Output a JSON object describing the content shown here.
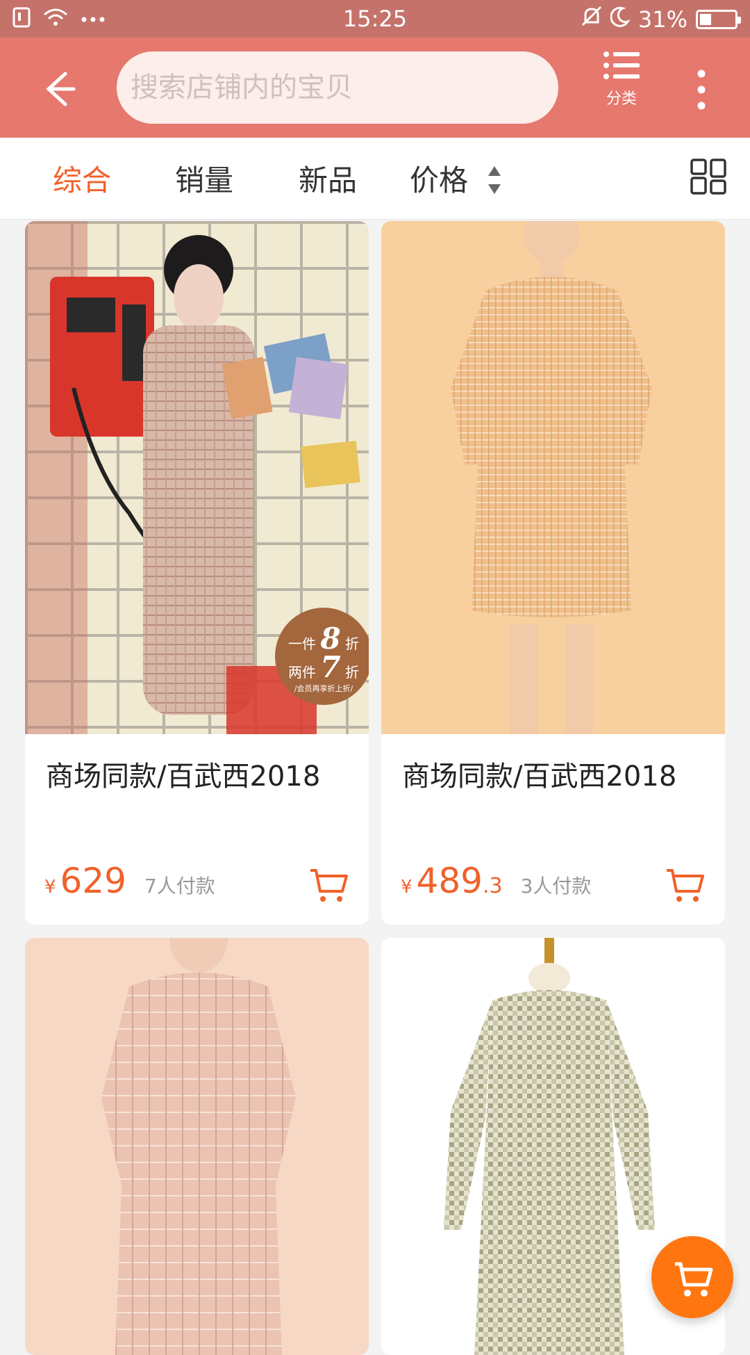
{
  "status_bar": {
    "time": "15:25",
    "battery": "31%"
  },
  "header": {
    "search_placeholder": "搜索店铺内的宝贝",
    "category_label": "分类",
    "icons": [
      "back-arrow-icon",
      "category-list-icon",
      "more-vertical-icon"
    ]
  },
  "tabs": [
    {
      "label": "综合",
      "active": true
    },
    {
      "label": "销量",
      "active": false
    },
    {
      "label": "新品",
      "active": false
    },
    {
      "label": "价格",
      "active": false
    }
  ],
  "products": [
    {
      "title": "商场同款/百武西2018",
      "price_int": "629",
      "price_dec": "",
      "sold": "7人付款",
      "promo_line1": "一件",
      "promo_num1": "8",
      "promo_unit1": "折",
      "promo_line2": "两件",
      "promo_num2": "7",
      "promo_unit2": "折",
      "promo_note": "/会员再享折上折/"
    },
    {
      "title": "商场同款/百武西2018",
      "price_int": "489",
      "price_dec": ".3",
      "sold": "3人付款"
    },
    {
      "title": "",
      "price_int": "",
      "price_dec": "",
      "sold": ""
    },
    {
      "title": "",
      "price_int": "",
      "price_dec": "",
      "sold": ""
    }
  ],
  "currency_symbol": "¥",
  "colors": {
    "header": "#e6786e",
    "status_bar": "#c5726a",
    "accent": "#f0612a",
    "fab": "#ff7611"
  }
}
